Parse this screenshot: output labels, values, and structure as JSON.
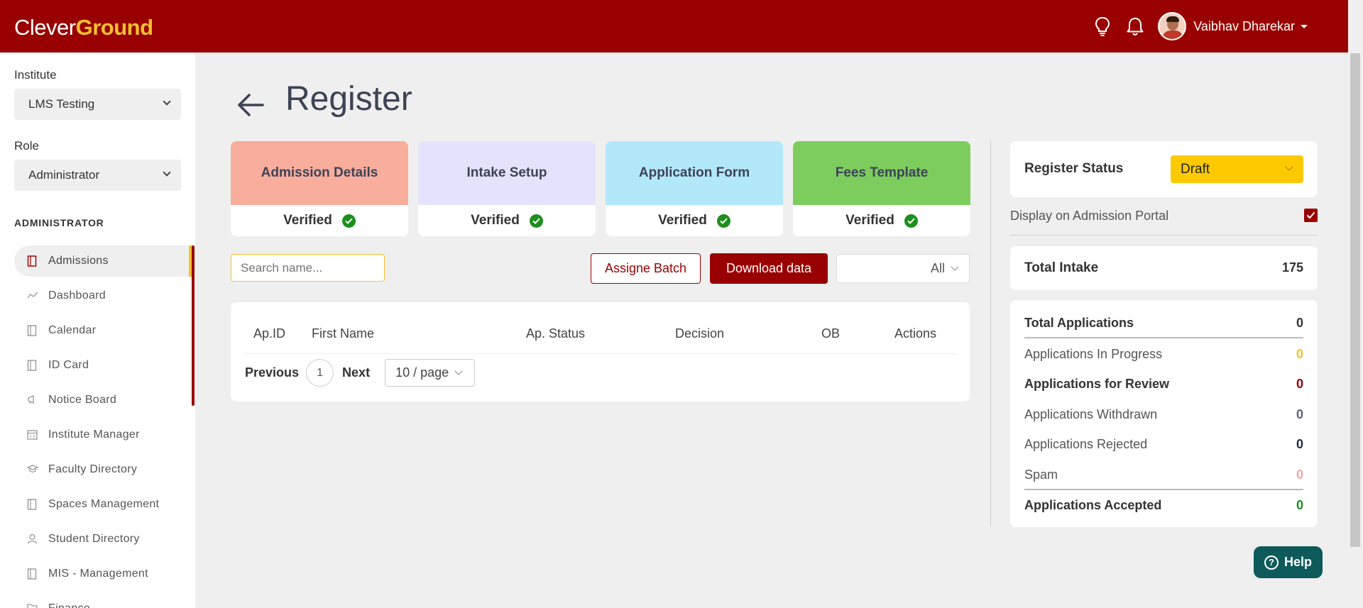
{
  "header": {
    "logo_part1": "Clever",
    "logo_part2": "Ground",
    "user_name": "Vaibhav Dharekar"
  },
  "sidebar": {
    "institute_label": "Institute",
    "institute_value": "LMS Testing",
    "role_label": "Role",
    "role_value": "Administrator",
    "section_title": "ADMINISTRATOR",
    "items": [
      {
        "label": "Admissions",
        "icon": "door-icon",
        "active": true
      },
      {
        "label": "Dashboard",
        "icon": "trend-icon"
      },
      {
        "label": "Calendar",
        "icon": "door-icon"
      },
      {
        "label": "ID Card",
        "icon": "door-icon"
      },
      {
        "label": "Notice Board",
        "icon": "megaphone-icon"
      },
      {
        "label": "Institute Manager",
        "icon": "calendar-icon"
      },
      {
        "label": "Faculty Directory",
        "icon": "mortarboard-icon"
      },
      {
        "label": "Spaces Management",
        "icon": "door-icon"
      },
      {
        "label": "Student Directory",
        "icon": "user-icon"
      },
      {
        "label": "MIS - Management",
        "icon": "door-icon"
      },
      {
        "label": "Finance",
        "icon": "folder-icon"
      }
    ]
  },
  "main": {
    "title": "Register",
    "cards": [
      {
        "title": "Admission Details",
        "status": "Verified",
        "color": "#f8ad9d"
      },
      {
        "title": "Intake Setup",
        "status": "Verified",
        "color": "#e5e3fb"
      },
      {
        "title": "Application Form",
        "status": "Verified",
        "color": "#b2e8fa"
      },
      {
        "title": "Fees Template",
        "status": "Verified",
        "color": "#7dcd5e"
      }
    ],
    "search_placeholder": "Search name...",
    "assign_batch_label": "Assigne Batch",
    "download_label": "Download data",
    "filter_value": "All",
    "table": {
      "columns": [
        "Ap.ID",
        "First Name",
        "Ap. Status",
        "Decision",
        "OB",
        "Actions"
      ],
      "rows": []
    },
    "pagination": {
      "prev": "Previous",
      "page": "1",
      "next": "Next",
      "page_size": "10 / page"
    }
  },
  "panel": {
    "status_label": "Register Status",
    "status_value": "Draft",
    "portal_label": "Display on Admission Portal",
    "portal_checked": true,
    "intake_label": "Total Intake",
    "intake_value": "175",
    "applications": [
      {
        "label": "Total Applications",
        "value": "0",
        "color": "#333333",
        "bold": true
      },
      {
        "label": "Applications In Progress",
        "value": "0",
        "color": "#f5c12e",
        "bold": false
      },
      {
        "label": "Applications for Review",
        "value": "0",
        "color": "#990000",
        "bold": true
      },
      {
        "label": "Applications Withdrawn",
        "value": "0",
        "color": "#5a6378",
        "bold": false
      },
      {
        "label": "Applications Rejected",
        "value": "0",
        "color": "#1f2a44",
        "bold": false
      },
      {
        "label": "Spam",
        "value": "0",
        "color": "#f2a5a5",
        "bold": false
      },
      {
        "label": "Applications Accepted",
        "value": "0",
        "color": "#1e8e1e",
        "bold": true
      }
    ]
  },
  "help_label": "Help",
  "colors": {
    "brand": "#990000",
    "accent": "#f5c12e"
  }
}
